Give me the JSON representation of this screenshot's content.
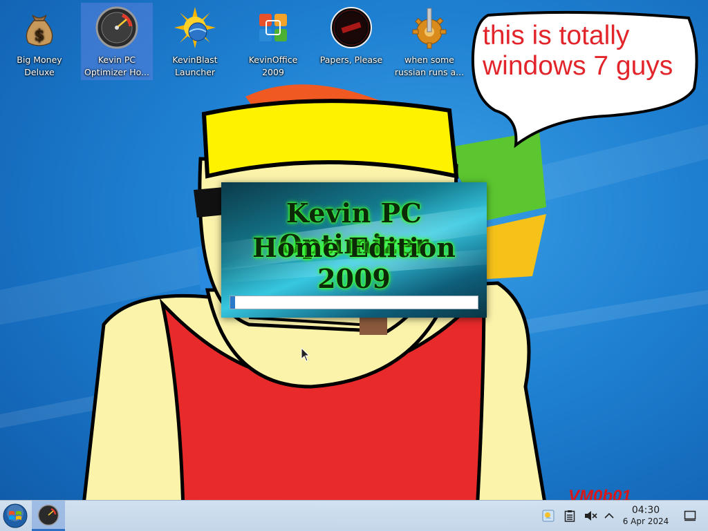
{
  "desktop": {
    "icons": [
      {
        "label": "Big Money Deluxe",
        "icon": "money-bag-icon",
        "selected": false
      },
      {
        "label": "Kevin PC Optimizer Ho...",
        "icon": "speedometer-icon",
        "selected": true
      },
      {
        "label": "KevinBlast Launcher",
        "icon": "sun-planet-icon",
        "selected": false
      },
      {
        "label": "KevinOffice 2009",
        "icon": "office-logo-icon",
        "selected": false
      },
      {
        "label": "Papers, Please",
        "icon": "papers-please-seal-icon",
        "selected": false
      },
      {
        "label": "when some russian runs a...",
        "icon": "gear-icon",
        "selected": false
      }
    ],
    "speech_bubble": {
      "line1": "this is totally",
      "line2": "windows 7 guys"
    },
    "watermark": "VM0b01"
  },
  "splash": {
    "title_line1": "Kevin PC Optimizer",
    "title_line2": "Home Edition 2009",
    "progress_fraction": 0.02,
    "colors": {
      "glow": "#38ff2a",
      "text": "#0c2a06",
      "progress": "#2a78c8"
    }
  },
  "taskbar": {
    "start_icon": "windows-orb-icon",
    "active_app_icon": "speedometer-icon",
    "tray_icons": [
      "weather-icon",
      "clipboard-icon",
      "volume-muted-icon",
      "chevron-up-icon"
    ],
    "clock_time": "04:30",
    "clock_date": "6 Apr 2024",
    "show_desktop_icon": "show-desktop-icon"
  }
}
